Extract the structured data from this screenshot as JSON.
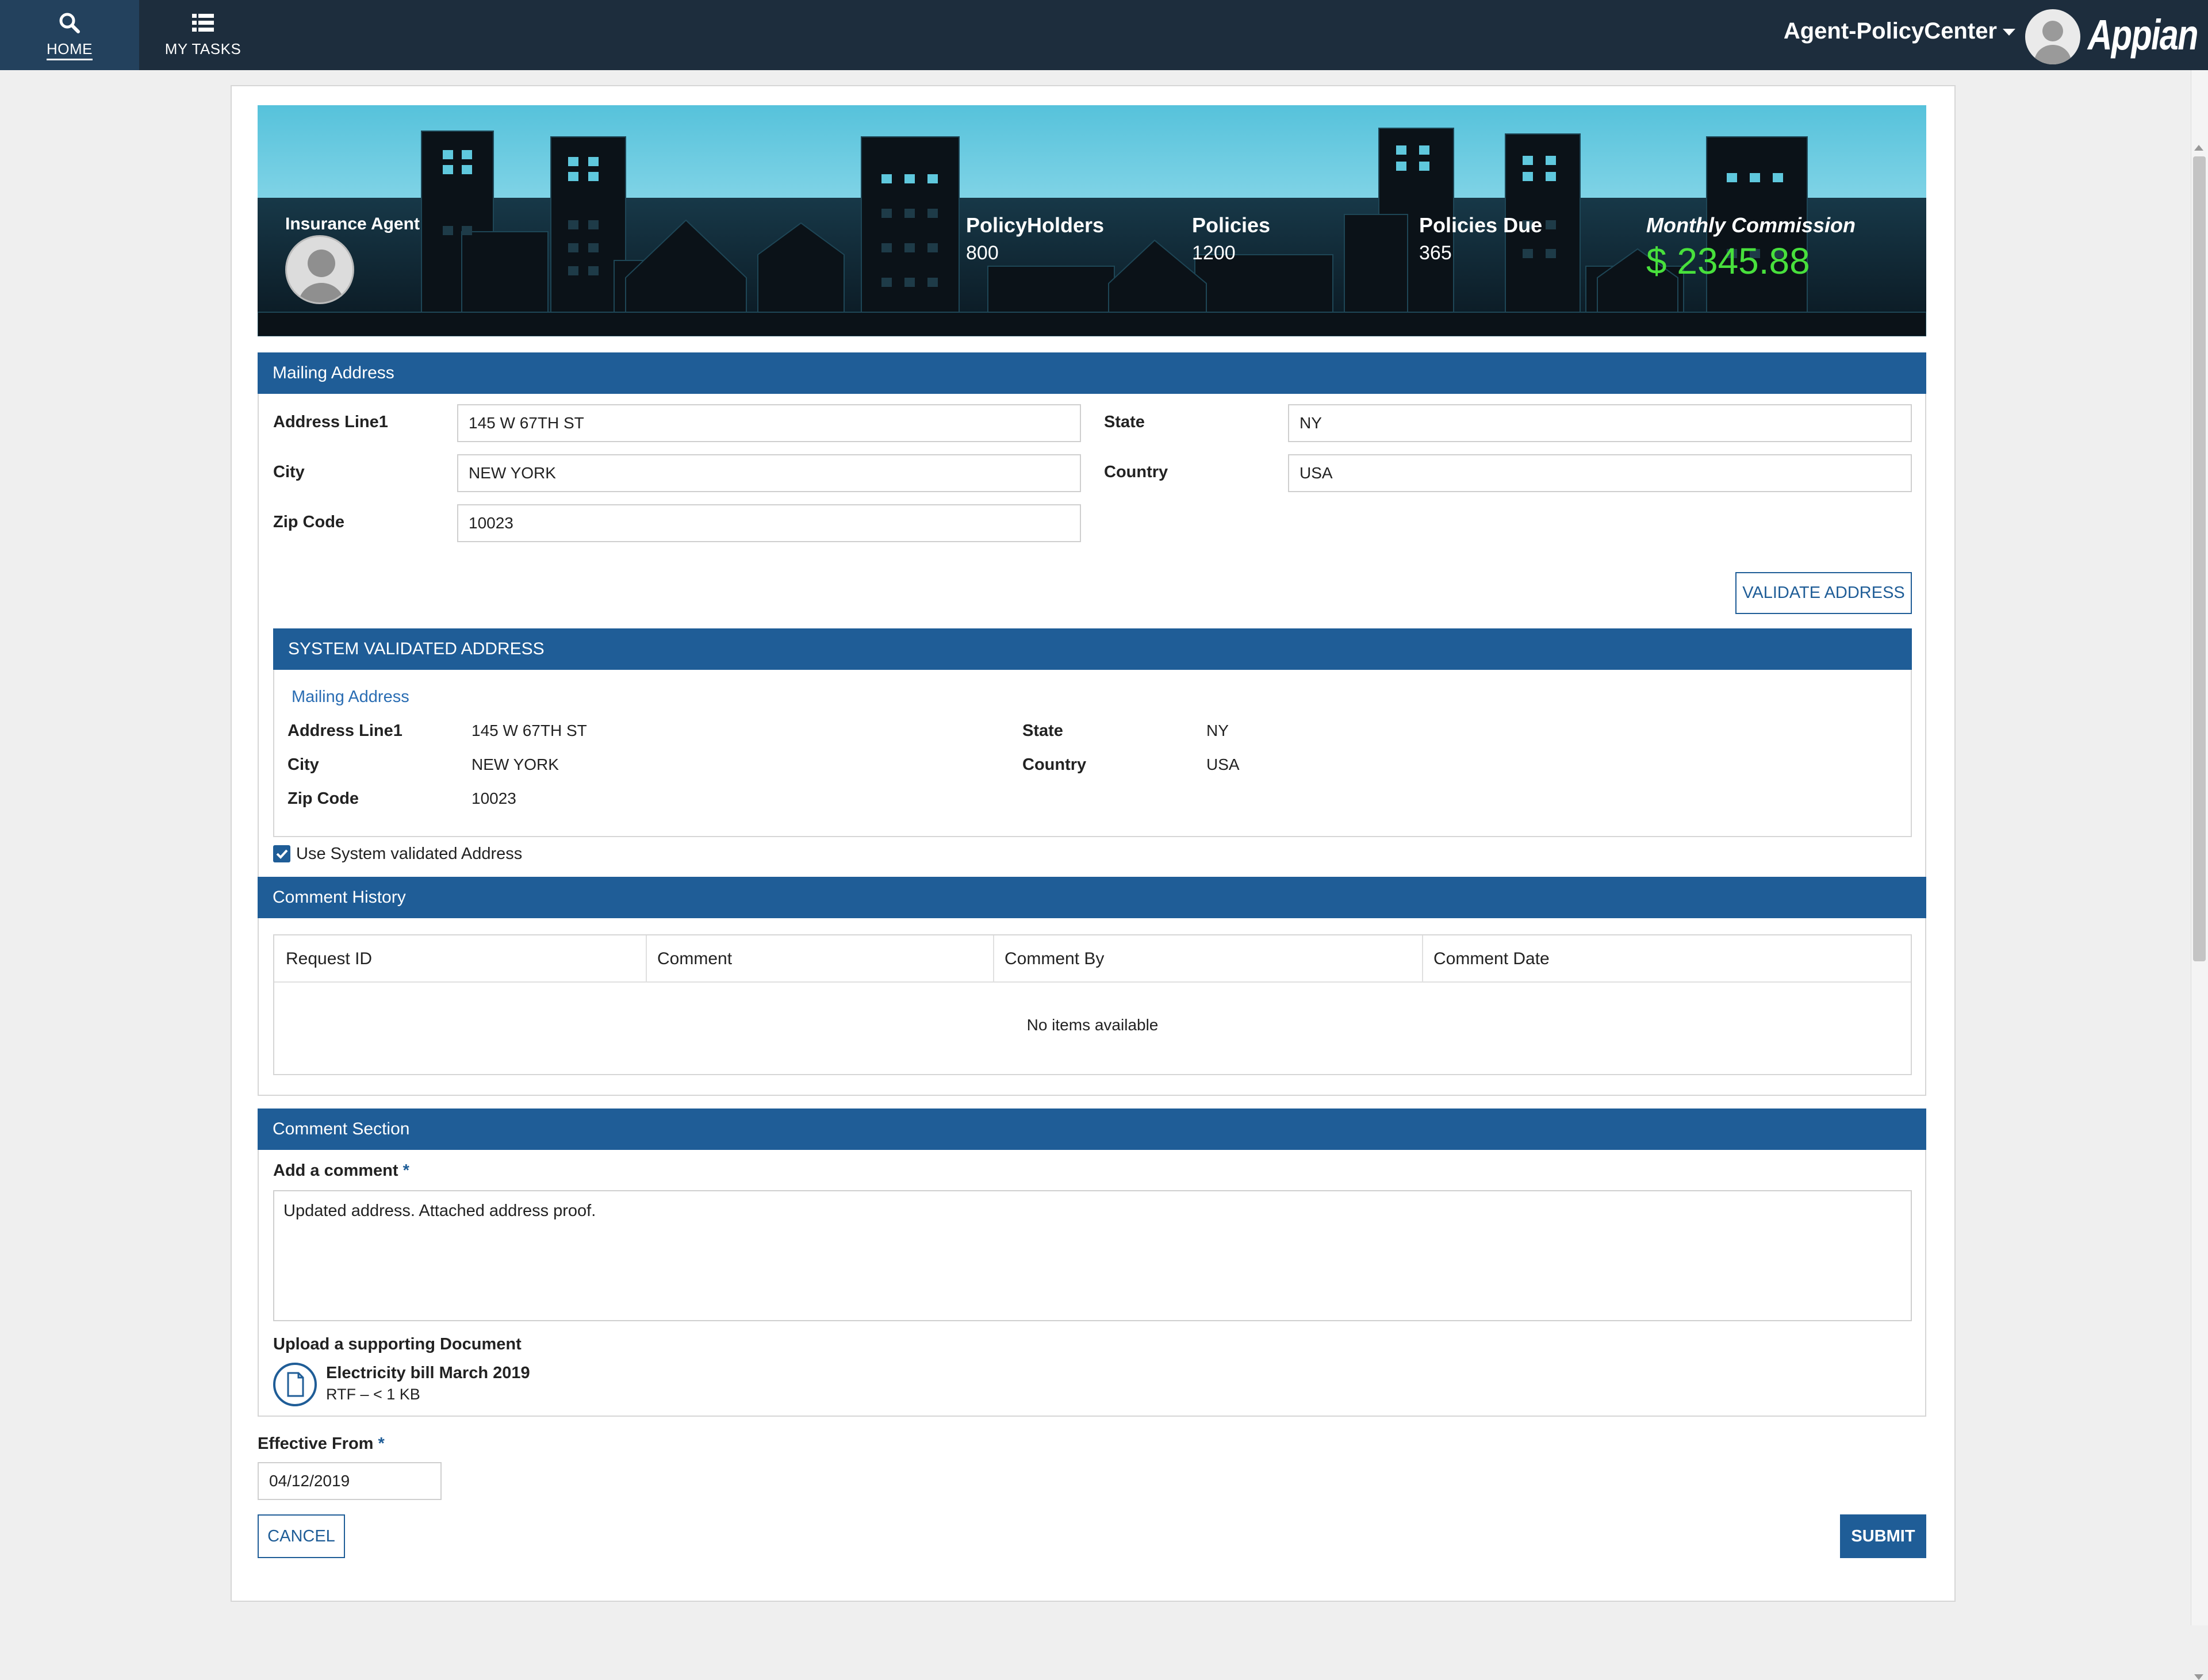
{
  "nav": {
    "home_label": "HOME",
    "tasks_label": "MY TASKS",
    "app_name": "Agent-PolicyCenter",
    "logo": "Appian",
    "home_icon": "search-icon",
    "tasks_icon": "list-icon"
  },
  "banner": {
    "agent_label": "Insurance Agent",
    "stats": [
      {
        "label": "PolicyHolders",
        "value": "800"
      },
      {
        "label": "Policies",
        "value": "1200"
      },
      {
        "label": "Policies Due",
        "value": "365"
      }
    ],
    "commission_label": "Monthly Commission",
    "commission_value": "$ 2345.88"
  },
  "mailing": {
    "title": "Mailing Address",
    "address1_label": "Address Line1",
    "address1": "145 W 67TH ST",
    "city_label": "City",
    "city": "NEW YORK",
    "zip_label": "Zip Code",
    "zip": "10023",
    "state_label": "State",
    "state": "NY",
    "country_label": "Country",
    "country": "USA",
    "validate_button": "VALIDATE ADDRESS"
  },
  "validated": {
    "title": "SYSTEM VALIDATED ADDRESS",
    "link": "Mailing Address",
    "address1_label": "Address Line1",
    "address1": "145 W 67TH ST",
    "city_label": "City",
    "city": "NEW YORK",
    "zip_label": "Zip Code",
    "zip": "10023",
    "state_label": "State",
    "state": "NY",
    "country_label": "Country",
    "country": "USA",
    "use_checkbox_label": "Use System validated  Address",
    "use_checked": true
  },
  "history": {
    "title": "Comment History",
    "columns": [
      "Request ID",
      "Comment",
      "Comment By",
      "Comment Date"
    ],
    "empty_text": "No items available"
  },
  "comment": {
    "title": "Comment Section",
    "add_label": "Add a comment",
    "required_mark": "*",
    "text": "Updated address. Attached address proof.",
    "upload_label": "Upload a supporting Document",
    "file_name": "Electricity bill March 2019",
    "file_meta": "RTF – < 1 KB",
    "file_icon": "document-icon"
  },
  "effective": {
    "label": "Effective From",
    "required_mark": "*",
    "value": "04/12/2019"
  },
  "actions": {
    "cancel": "CANCEL",
    "submit": "SUBMIT"
  },
  "colors": {
    "nav_bg": "#1d2d3d",
    "accent": "#1f5d97",
    "commission": "#48e03c"
  }
}
